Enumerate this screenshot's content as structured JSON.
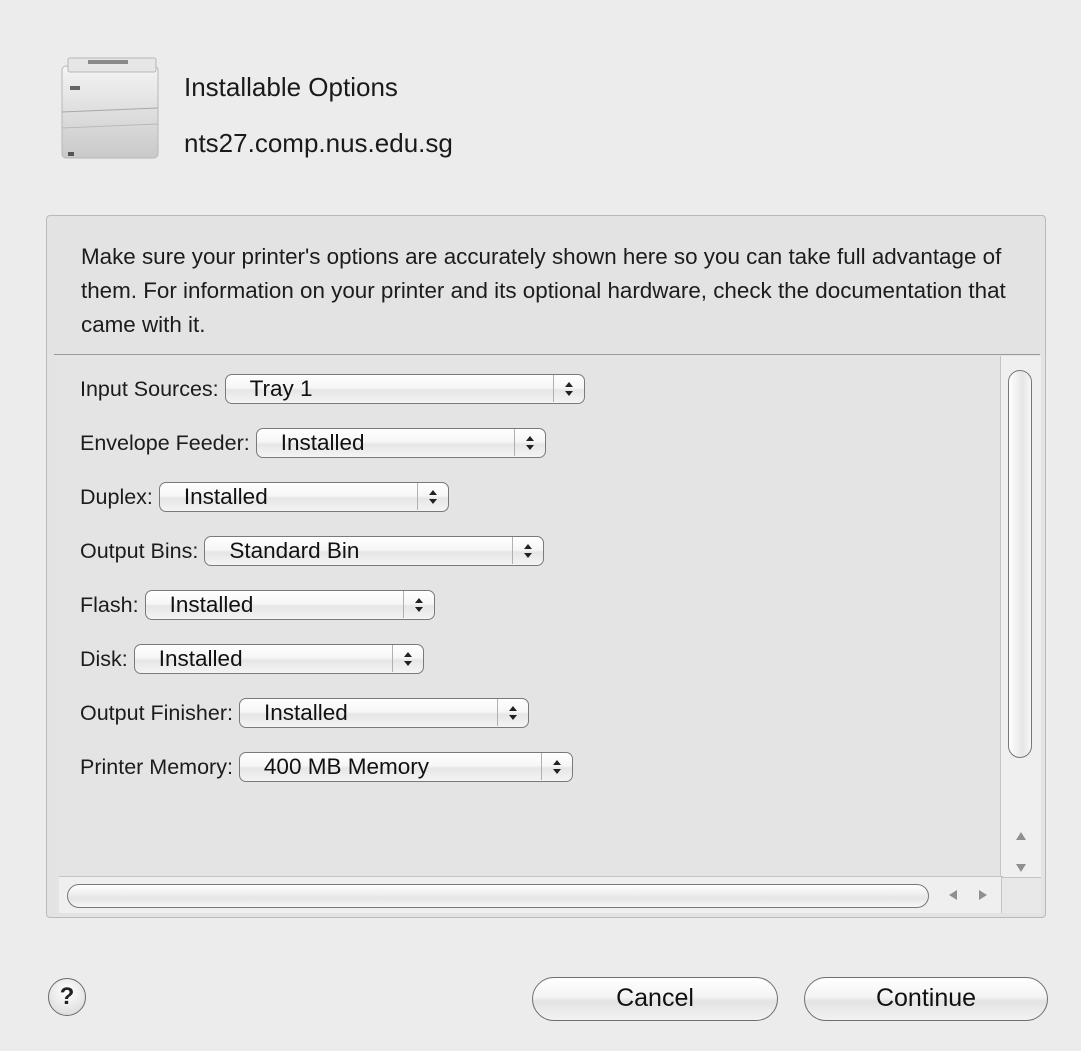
{
  "header": {
    "title": "Installable Options",
    "hostname": "nts27.comp.nus.edu.sg",
    "icon": "printer-icon"
  },
  "description": "Make sure your printer's options are accurately shown here so you can take full advantage of them.  For information on your printer and its optional hardware, check the documentation that came with it.",
  "options": [
    {
      "label": "Input Sources:",
      "value": "Tray 1"
    },
    {
      "label": "Envelope Feeder:",
      "value": "Installed"
    },
    {
      "label": "Duplex:",
      "value": "Installed"
    },
    {
      "label": "Output Bins:",
      "value": "Standard Bin"
    },
    {
      "label": "Flash:",
      "value": "Installed"
    },
    {
      "label": "Disk:",
      "value": "Installed"
    },
    {
      "label": "Output Finisher:",
      "value": "Installed"
    },
    {
      "label": "Printer Memory:",
      "value": "400 MB Memory"
    }
  ],
  "buttons": {
    "help": "?",
    "cancel": "Cancel",
    "continue": "Continue"
  }
}
